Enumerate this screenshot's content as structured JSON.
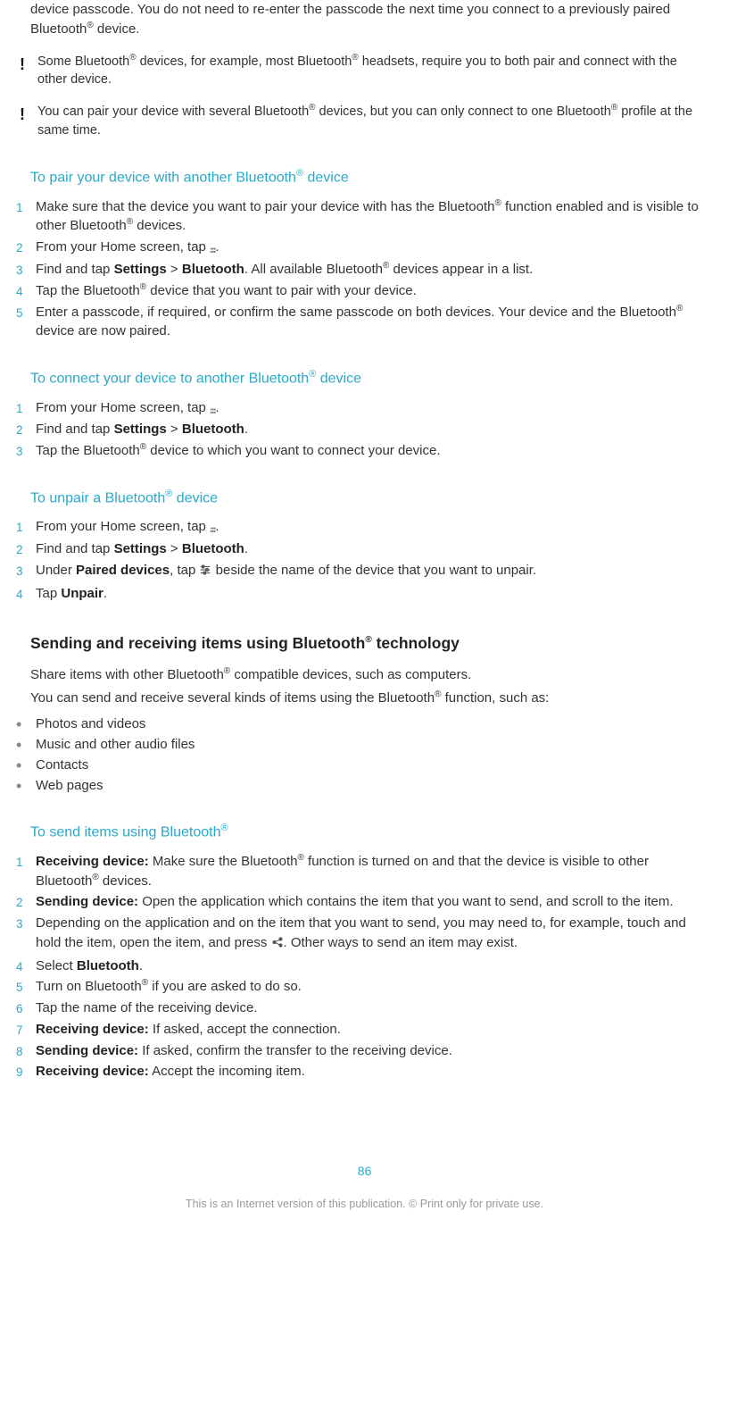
{
  "intro_para": "device passcode. You do not need to re-enter the passcode the next time you connect to a previously paired Bluetooth® device.",
  "notes": [
    "Some Bluetooth® devices, for example, most Bluetooth® headsets, require you to both pair and connect with the other device.",
    "You can pair your device with several Bluetooth® devices, but you can only connect to one Bluetooth® profile at the same time."
  ],
  "pair_heading": "To pair your device with another Bluetooth® device",
  "pair_steps": [
    "Make sure that the device you want to pair your device with has the Bluetooth® function enabled and is visible to other Bluetooth® devices.",
    "From your Home screen, tap {apps}.",
    "Find and tap <b>Settings</b> > <b>Bluetooth</b>. All available Bluetooth® devices appear in a list.",
    "Tap the Bluetooth® device that you want to pair with your device.",
    "Enter a passcode, if required, or confirm the same passcode on both devices. Your device and the Bluetooth® device are now paired."
  ],
  "connect_heading": "To connect your device to another Bluetooth® device",
  "connect_steps": [
    "From your Home screen, tap {apps}.",
    "Find and tap <b>Settings</b> > <b>Bluetooth</b>.",
    "Tap the Bluetooth® device to which you want to connect your device."
  ],
  "unpair_heading": "To unpair a Bluetooth® device",
  "unpair_steps": [
    "From your Home screen, tap {apps}.",
    "Find and tap <b>Settings</b> > <b>Bluetooth</b>.",
    "Under <b>Paired devices</b>, tap {sliders} beside the name of the device that you want to unpair.",
    "Tap <b>Unpair</b>."
  ],
  "send_recv_heading": "Sending and receiving items using Bluetooth® technology",
  "send_recv_para1": "Share items with other Bluetooth® compatible devices, such as computers.",
  "send_recv_para2": "You can send and receive several kinds of items using the Bluetooth® function, such as:",
  "bullets": [
    "Photos and videos",
    "Music and other audio files",
    "Contacts",
    "Web pages"
  ],
  "send_heading": "To send items using Bluetooth®",
  "send_steps": [
    "<b>Receiving device:</b> Make sure the Bluetooth® function is turned on and that the device is visible to other Bluetooth® devices.",
    "<b>Sending device:</b> Open the application which contains the item that you want to send, and scroll to the item.",
    "Depending on the application and on the item that you want to send, you may need to, for example, touch and hold the item, open the item, and press {share}. Other ways to send an item may exist.",
    "Select <b>Bluetooth</b>.",
    "Turn on Bluetooth® if you are asked to do so.",
    "Tap the name of the receiving device.",
    "<b>Receiving device:</b> If asked, accept the connection.",
    "<b>Sending device:</b> If asked, confirm the transfer to the receiving device.",
    "<b>Receiving device:</b> Accept the incoming item."
  ],
  "page_number": "86",
  "footer_text": "This is an Internet version of this publication. © Print only for private use."
}
